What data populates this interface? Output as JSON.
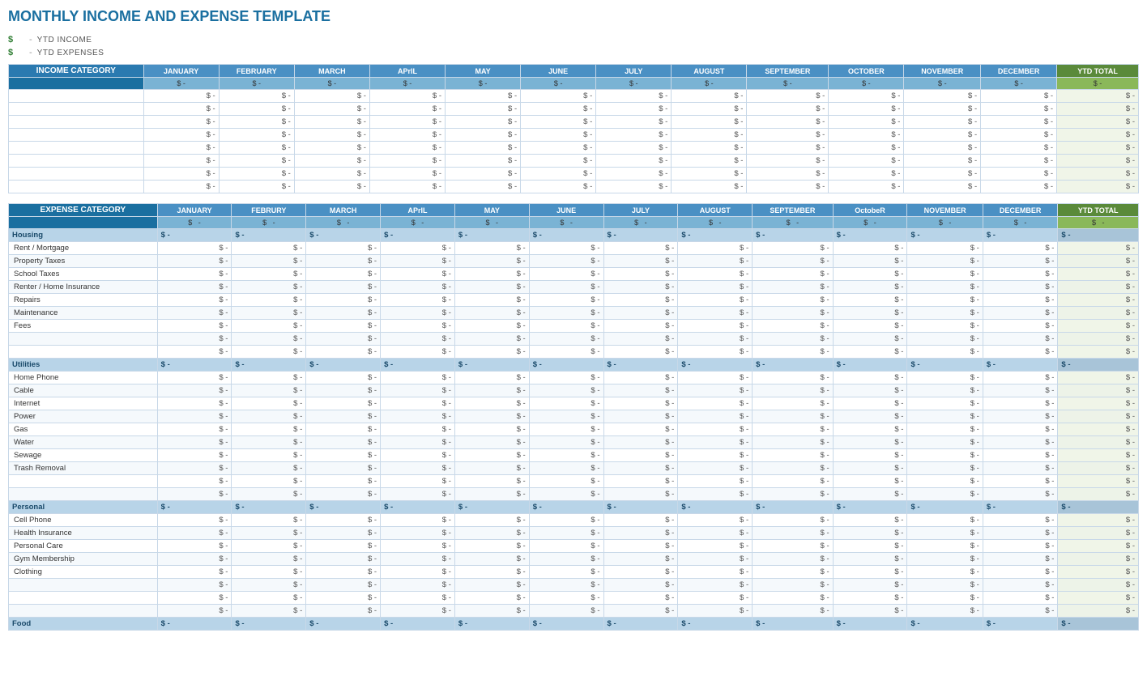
{
  "title": "MONTHLY INCOME AND EXPENSE TEMPLATE",
  "ytd": {
    "income_label": "YTD INCOME",
    "expense_label": "YTD EXPENSES",
    "dollar": "$",
    "dash": "-"
  },
  "months": [
    "JANUARY",
    "FEBRUARY",
    "MARCH",
    "APRIL",
    "MAY",
    "JUNE",
    "JULY",
    "AUGUST",
    "SEPTEMBER",
    "OCTOBER",
    "NOVEMBER",
    "DECEMBER"
  ],
  "months_expense": [
    "JANUARY",
    "FEBRURY",
    "MARCH",
    "APRIL",
    "MAY",
    "JUNE",
    "JULY",
    "AUGUST",
    "SEPTEMBER",
    "OCTOBER",
    "NOVEMBER",
    "DECEMBER"
  ],
  "ytd_label": "YTD TOTAL",
  "income_category_label": "INCOME CATEGORY",
  "expense_category_label": "EXPENSE CATEGORY",
  "dollar_sign": "$",
  "dash_value": "-",
  "income_rows": [
    {
      "label": "",
      "values": [
        "$",
        "-",
        "$",
        "-",
        "$",
        "-",
        "$",
        "-",
        "$",
        "-",
        "$",
        "-",
        "$",
        "-",
        "$",
        "-",
        "$",
        "-",
        "$",
        "-",
        "$",
        "-",
        "$",
        "-",
        "$",
        "-"
      ]
    },
    {
      "label": "",
      "values": [
        "$",
        "-",
        "$",
        "-",
        "$",
        "-",
        "$",
        "-",
        "$",
        "-",
        "$",
        "-",
        "$",
        "-",
        "$",
        "-",
        "$",
        "-",
        "$",
        "-",
        "$",
        "-",
        "$",
        "-",
        "$",
        "-"
      ]
    },
    {
      "label": "",
      "values": [
        "$",
        "-",
        "$",
        "-",
        "$",
        "-",
        "$",
        "-",
        "$",
        "-",
        "$",
        "-",
        "$",
        "-",
        "$",
        "-",
        "$",
        "-",
        "$",
        "-",
        "$",
        "-",
        "$",
        "-",
        "$",
        "-"
      ]
    },
    {
      "label": "",
      "values": [
        "$",
        "-",
        "$",
        "-",
        "$",
        "-",
        "$",
        "-",
        "$",
        "-",
        "$",
        "-",
        "$",
        "-",
        "$",
        "-",
        "$",
        "-",
        "$",
        "-",
        "$",
        "-",
        "$",
        "-",
        "$",
        "-"
      ]
    },
    {
      "label": "",
      "values": [
        "$",
        "-",
        "$",
        "-",
        "$",
        "-",
        "$",
        "-",
        "$",
        "-",
        "$",
        "-",
        "$",
        "-",
        "$",
        "-",
        "$",
        "-",
        "$",
        "-",
        "$",
        "-",
        "$",
        "-",
        "$",
        "-"
      ]
    },
    {
      "label": "",
      "values": [
        "$",
        "-",
        "$",
        "-",
        "$",
        "-",
        "$",
        "-",
        "$",
        "-",
        "$",
        "-",
        "$",
        "-",
        "$",
        "-",
        "$",
        "-",
        "$",
        "-",
        "$",
        "-",
        "$",
        "-",
        "$",
        "-"
      ]
    },
    {
      "label": "",
      "values": [
        "$",
        "-",
        "$",
        "-",
        "$",
        "-",
        "$",
        "-",
        "$",
        "-",
        "$",
        "-",
        "$",
        "-",
        "$",
        "-",
        "$",
        "-",
        "$",
        "-",
        "$",
        "-",
        "$",
        "-",
        "$",
        "-"
      ]
    },
    {
      "label": "",
      "values": [
        "$",
        "-",
        "$",
        "-",
        "$",
        "-",
        "$",
        "-",
        "$",
        "-",
        "$",
        "-",
        "$",
        "-",
        "$",
        "-",
        "$",
        "-",
        "$",
        "-",
        "$",
        "-",
        "$",
        "-",
        "$",
        "-"
      ]
    }
  ],
  "expense_sections": [
    {
      "name": "Housing",
      "items": [
        "Rent / Mortgage",
        "Property Taxes",
        "School Taxes",
        "Renter / Home Insurance",
        "Repairs",
        "Maintenance",
        "Fees",
        "",
        ""
      ]
    },
    {
      "name": "Utilities",
      "items": [
        "Home Phone",
        "Cable",
        "Internet",
        "Power",
        "Gas",
        "Water",
        "Sewage",
        "Trash Removal",
        "",
        ""
      ]
    },
    {
      "name": "Personal",
      "items": [
        "Cell Phone",
        "Health Insurance",
        "Personal Care",
        "Gym Membership",
        "Clothing",
        "",
        "",
        ""
      ]
    },
    {
      "name": "Food",
      "items": []
    }
  ]
}
